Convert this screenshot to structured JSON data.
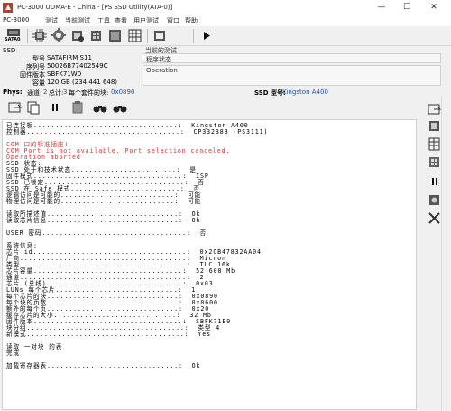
{
  "window": {
    "title": "PC-3000 UDMA-E - China - [PS SSD Utility(ATA-0)]",
    "minimize_glyph": "—",
    "maximize_glyph": "☐",
    "close_glyph": "✕"
  },
  "menu": [
    "PC-3000",
    "测试",
    "当前测试",
    "工具",
    "查看",
    "用户测试",
    "窗口",
    "帮助"
  ],
  "toolbar": {
    "sata_label": "SATA0",
    "icons": [
      "disk-icon",
      "chip-icon",
      "gear-chip-icon",
      "settings-chip-icon",
      "module-chip-icon",
      "table-icon",
      "play-icon"
    ]
  },
  "ssd": {
    "section_label": "SSD",
    "fields": [
      {
        "label": "型号",
        "value": "SATAFIRM   S11"
      },
      {
        "label": "序列号",
        "value": "50026B77402549C"
      },
      {
        "label": "固件版本",
        "value": "SBFK71W0"
      },
      {
        "label": "容量",
        "value": "120 GB (234 441 648)"
      }
    ]
  },
  "groups": {
    "current_test": "当前的测试",
    "program_status": "程序状态",
    "operation": "Operation"
  },
  "status": {
    "phys_label": "Phys:",
    "channel_label": "通道:",
    "channel_value": "2",
    "total_label": "总计:",
    "total_value": "3",
    "block_label": "每个套件的块:",
    "block_value": "0x0890",
    "ssd_label": "SSD 型号:",
    "ssd_value": "Kingston A400"
  },
  "log": {
    "lines": [
      {
        "text": "已连接板.................................:  Kingston A400",
        "color": "#000000"
      },
      {
        "text": "控制器...................................:  CP33238B (PS3111)",
        "color": "#000000"
      },
      {
        "text": "",
        "color": "#000000"
      },
      {
        "text": "COM 口的标准插座!",
        "color": "#e03030"
      },
      {
        "text": "COM Port is not available. Port selection canceled.",
        "color": "#e03030"
      },
      {
        "text": "Operation aborted",
        "color": "#e03030"
      },
      {
        "text": "SSD 状态:",
        "color": "#000000"
      },
      {
        "text": "SSD 处于和技术状态........................:  是",
        "color": "#000000"
      },
      {
        "text": "固件模式..................................:  ISP",
        "color": "#000000"
      },
      {
        "text": "SSD 已锁定................................:  否",
        "color": "#000000"
      },
      {
        "text": "SSD 在 Safe 模式.........................:  否",
        "color": "#000000"
      },
      {
        "text": "逻辑访问是可能的..........................:  可能",
        "color": "#000000"
      },
      {
        "text": "物理访问是可能的..........................:  可能",
        "color": "#000000"
      },
      {
        "text": "",
        "color": "#000000"
      },
      {
        "text": "读取所描述值..............................:  Ok",
        "color": "#000000"
      },
      {
        "text": "读取芯片信息..............................:  Ok",
        "color": "#000000"
      },
      {
        "text": "",
        "color": "#000000"
      },
      {
        "text": "USER 密码.................................:  否",
        "color": "#000000"
      },
      {
        "text": "",
        "color": "#000000"
      },
      {
        "text": "系统信息:",
        "color": "#000000"
      },
      {
        "text": "芯片 id...................................:  0x2CB47832AA04",
        "color": "#000000"
      },
      {
        "text": "厂商......................................:  Micron",
        "color": "#000000"
      },
      {
        "text": "类型......................................:  TLC 16k",
        "color": "#000000"
      },
      {
        "text": "芯片容量..................................:  52 608 Mb",
        "color": "#000000"
      },
      {
        "text": "通道......................................:  2",
        "color": "#000000"
      },
      {
        "text": "芯片 (总线)...............................:  0x03",
        "color": "#000000"
      },
      {
        "text": "LUNs 每个芯片............................:  1",
        "color": "#000000"
      },
      {
        "text": "每个芯片的块..............................:  0x0890",
        "color": "#000000"
      },
      {
        "text": "每个块的页数..............................:  0x0600",
        "color": "#000000"
      },
      {
        "text": "额外的每个页..............................:  0x20",
        "color": "#000000"
      },
      {
        "text": "缓存芯片的大小............................:  32 Mb",
        "color": "#000000"
      },
      {
        "text": "固件版本..................................:  SBFK71E0",
        "color": "#000000"
      },
      {
        "text": "块分组....................................:  类型 4",
        "color": "#000000"
      },
      {
        "text": "新模式....................................:  Yes",
        "color": "#000000"
      },
      {
        "text": "",
        "color": "#000000"
      },
      {
        "text": "读取 一对块 的表",
        "color": "#000000"
      },
      {
        "text": "完成",
        "color": "#000000"
      },
      {
        "text": "",
        "color": "#000000"
      },
      {
        "text": "加载寄存器表..............................:  Ok",
        "color": "#000000"
      }
    ]
  }
}
